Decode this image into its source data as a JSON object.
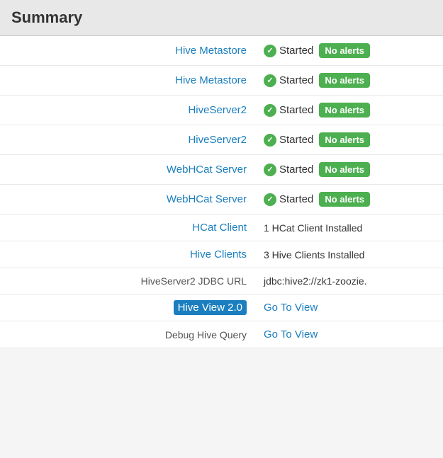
{
  "header": {
    "title": "Summary"
  },
  "rows": [
    {
      "id": "hive-metastore-1",
      "label": "Hive Metastore",
      "label_link": true,
      "status_type": "started_badge",
      "status_text": "Started",
      "badge_text": "No alerts"
    },
    {
      "id": "hive-metastore-2",
      "label": "Hive Metastore",
      "label_link": true,
      "status_type": "started_badge",
      "status_text": "Started",
      "badge_text": "No alerts"
    },
    {
      "id": "hiveserver2-1",
      "label": "HiveServer2",
      "label_link": true,
      "status_type": "started_badge",
      "status_text": "Started",
      "badge_text": "No alerts"
    },
    {
      "id": "hiveserver2-2",
      "label": "HiveServer2",
      "label_link": true,
      "status_type": "started_badge",
      "status_text": "Started",
      "badge_text": "No alerts"
    },
    {
      "id": "webhcat-server-1",
      "label": "WebHCat Server",
      "label_link": true,
      "status_type": "started_badge",
      "status_text": "Started",
      "badge_text": "No alerts"
    },
    {
      "id": "webhcat-server-2",
      "label": "WebHCat Server",
      "label_link": true,
      "status_type": "started_badge",
      "status_text": "Started",
      "badge_text": "No alerts"
    },
    {
      "id": "hcat-client",
      "label": "HCat Client",
      "label_link": true,
      "status_type": "text",
      "status_text": "1 HCat Client Installed"
    },
    {
      "id": "hive-clients",
      "label": "Hive Clients",
      "label_link": true,
      "status_type": "text",
      "status_text": "3 Hive Clients Installed"
    },
    {
      "id": "jdbc-url",
      "label": "HiveServer2 JDBC URL",
      "label_link": false,
      "status_type": "text",
      "status_text": "jdbc:hive2://zk1-zoozie."
    },
    {
      "id": "hive-view",
      "label": "Hive View 2.0",
      "label_link": false,
      "label_highlighted": true,
      "status_type": "link",
      "status_text": "Go To View"
    },
    {
      "id": "debug-hive-query",
      "label": "Debug Hive Query",
      "label_link": false,
      "status_type": "link",
      "status_text": "Go To View"
    }
  ],
  "badges": {
    "no_alerts": "No alerts"
  },
  "links": {
    "go_to_view": "Go To View"
  }
}
